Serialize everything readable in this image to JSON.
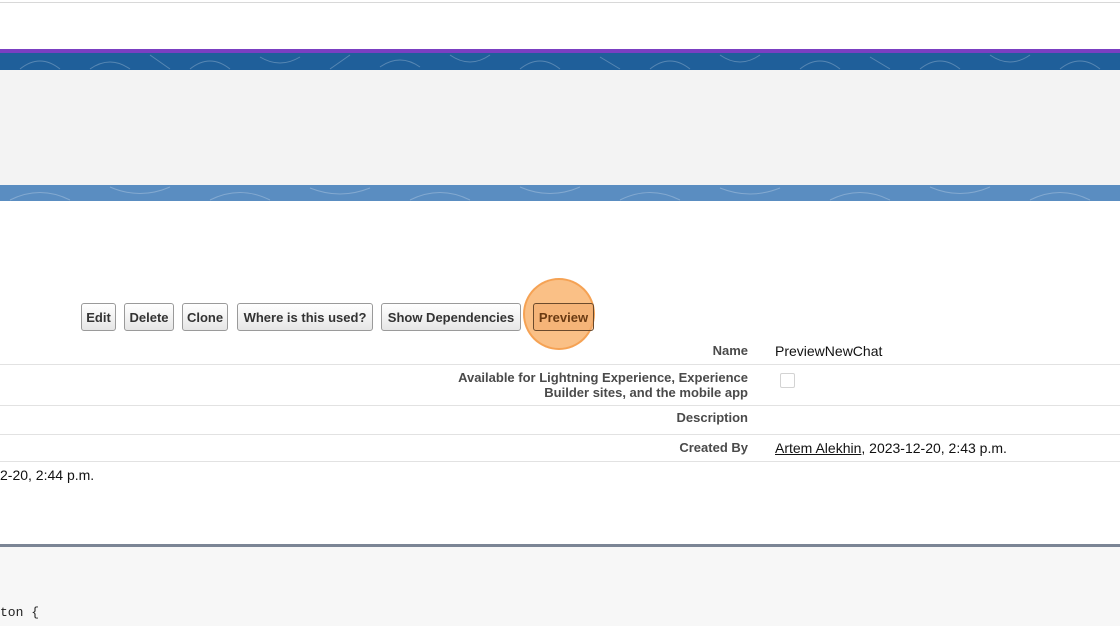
{
  "buttons": {
    "edit": "Edit",
    "delete": "Delete",
    "clone": "Clone",
    "where_used": "Where is this used?",
    "show_dependencies": "Show Dependencies",
    "preview": "Preview"
  },
  "detail": {
    "name_label": "Name",
    "name_value": "PreviewNewChat",
    "lightning_label_line1": "Available for Lightning Experience, Experience",
    "lightning_label_line2": "Builder sites, and the mobile app",
    "lightning_checked": false,
    "description_label": "Description",
    "description_value": "",
    "created_by_label": "Created By",
    "created_by_user": "Artem Alekhin",
    "created_by_date": ",  2023-12-20, 2:43 p.m."
  },
  "modified_fragment": "2-20, 2:44 p.m.",
  "code_fragment": "ton {",
  "colors": {
    "banner_blue": "#1f5f9a",
    "banner_purple": "#7b3fc2",
    "banner_light_blue": "#5a8dc1",
    "highlight_orange": "#f8ae64"
  }
}
